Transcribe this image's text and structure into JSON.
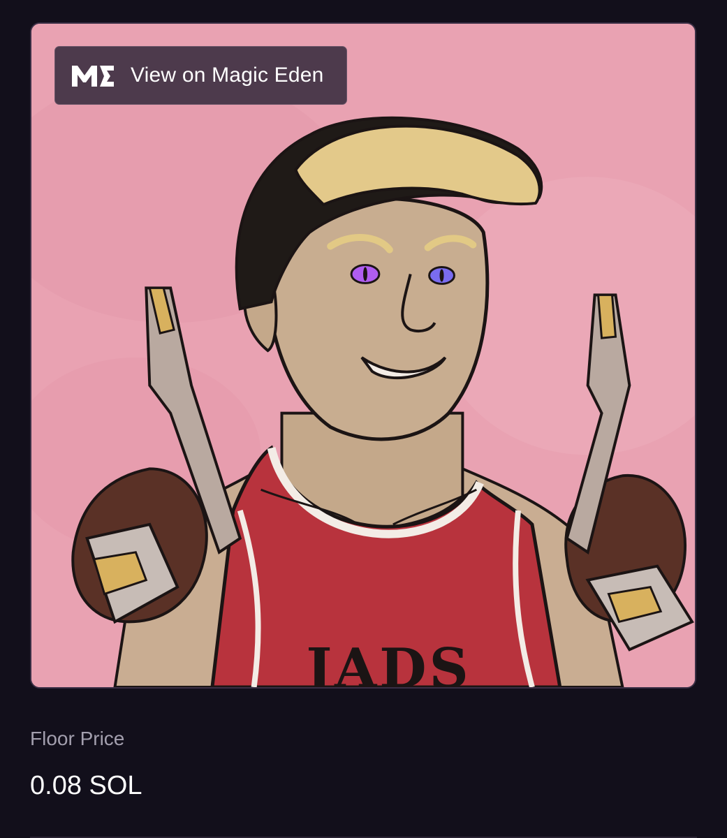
{
  "magic_eden_button": {
    "label": "View on Magic Eden",
    "icon": "magic-eden-logo-icon"
  },
  "nft": {
    "background_color": "#e9a2b2",
    "description": ""
  },
  "stats": {
    "floor_price_label": "Floor Price",
    "floor_price_value": "0.08 SOL"
  },
  "colors": {
    "page_background": "#120f1b",
    "button_background": "#4d3a4c",
    "muted_text": "#a39fae",
    "primary_text": "#ffffff"
  }
}
